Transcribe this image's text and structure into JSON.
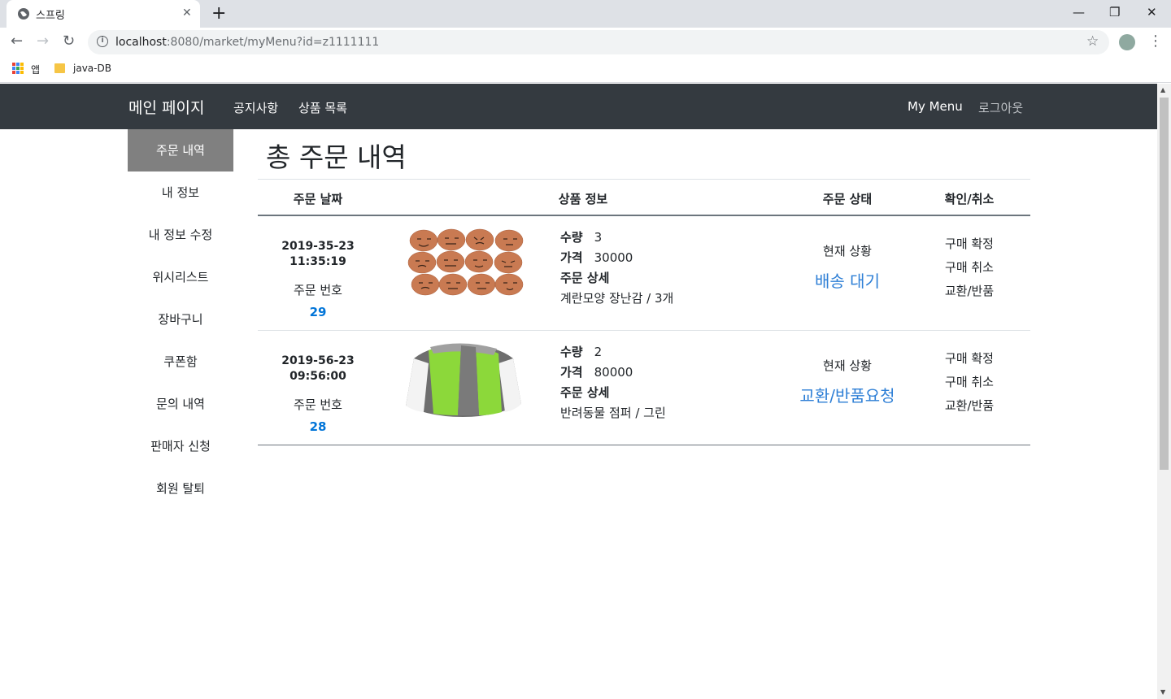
{
  "browser": {
    "tab_title": "스프링",
    "url_host": "localhost",
    "url_rest": ":8080/market/myMenu?id=z1111111",
    "bookmarks": [
      "앱",
      "java-DB"
    ]
  },
  "navbar": {
    "brand": "메인 페이지",
    "links": [
      "공지사항",
      "상품 목록"
    ],
    "my_menu": "My Menu",
    "logout": "로그아웃",
    "bg_color": "#343a40"
  },
  "sidebar": {
    "items": [
      {
        "label": "주문 내역",
        "active": true
      },
      {
        "label": "내 정보"
      },
      {
        "label": "내 정보 수정"
      },
      {
        "label": "위시리스트"
      },
      {
        "label": "장바구니"
      },
      {
        "label": "쿠폰함"
      },
      {
        "label": "문의 내역"
      },
      {
        "label": "판매자 신청"
      },
      {
        "label": "회원 탈퇴"
      }
    ]
  },
  "main": {
    "title": "총 주문 내역",
    "columns": [
      "주문 날짜",
      "상품 정보",
      "주문 상태",
      "확인/취소"
    ],
    "order_no_label": "주문 번호",
    "qty_label": "수량",
    "price_label": "가격",
    "detail_label": "주문 상세",
    "status_label": "현재 상황",
    "actions": [
      "구매 확정",
      "구매 취소",
      "교환/반품"
    ],
    "orders": [
      {
        "date": "2019-35-23",
        "time": "11:35:19",
        "order_no": "29",
        "qty": "3",
        "price": "30000",
        "detail": "계란모양 장난감 / 3개",
        "status": "배송 대기"
      },
      {
        "date": "2019-56-23",
        "time": "09:56:00",
        "order_no": "28",
        "qty": "2",
        "price": "80000",
        "detail": "반려동물 점퍼 / 그린",
        "status": "교환/반품요청"
      }
    ]
  }
}
